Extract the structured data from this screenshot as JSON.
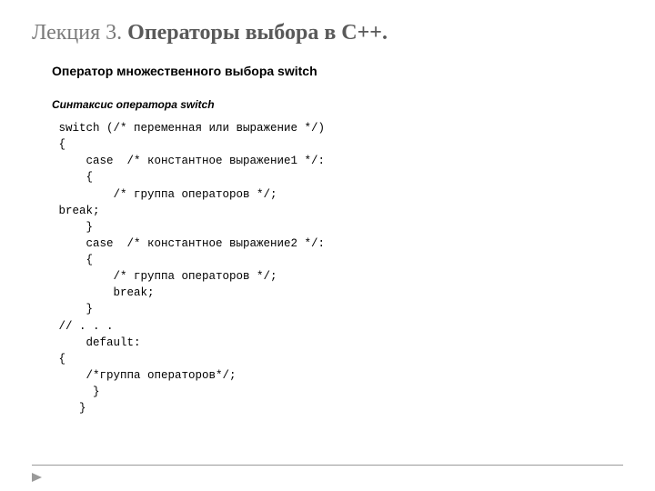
{
  "title": {
    "light": "Лекция 3. ",
    "bold": "Операторы выбора в С++."
  },
  "subtitle": "Оператор множественного выбора switch",
  "syntaxLabel": "Синтаксис оператора switch",
  "code": " switch (/* переменная или выражение */)\n {\n     case  /* константное выражение1 */:\n     {\n         /* группа операторов */;\n break;\n     }\n     case  /* константное выражение2 */:\n     {\n         /* группа операторов */;\n         break;\n     }\n // . . .\n     default:\n {\n     /*группа операторов*/;\n      }\n    }"
}
